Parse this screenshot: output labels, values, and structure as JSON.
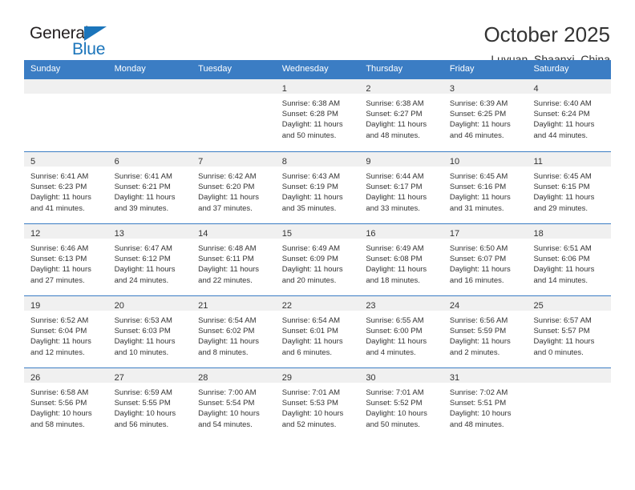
{
  "brand": {
    "name_top": "General",
    "name_bottom": "Blue",
    "accent_color": "#1b75bb",
    "triangle_icon": "triangle-icon"
  },
  "header": {
    "title": "October 2025",
    "subtitle": "Luyuan, Shaanxi, China"
  },
  "calendar": {
    "header_color": "#3b7dc4",
    "day_band_color": "#f0f0f0",
    "weekdays": [
      "Sunday",
      "Monday",
      "Tuesday",
      "Wednesday",
      "Thursday",
      "Friday",
      "Saturday"
    ],
    "weeks": [
      [
        {
          "day": "",
          "empty": true
        },
        {
          "day": "",
          "empty": true
        },
        {
          "day": "",
          "empty": true
        },
        {
          "day": "1",
          "sunrise": "Sunrise: 6:38 AM",
          "sunset": "Sunset: 6:28 PM",
          "daylight": "Daylight: 11 hours and 50 minutes."
        },
        {
          "day": "2",
          "sunrise": "Sunrise: 6:38 AM",
          "sunset": "Sunset: 6:27 PM",
          "daylight": "Daylight: 11 hours and 48 minutes."
        },
        {
          "day": "3",
          "sunrise": "Sunrise: 6:39 AM",
          "sunset": "Sunset: 6:25 PM",
          "daylight": "Daylight: 11 hours and 46 minutes."
        },
        {
          "day": "4",
          "sunrise": "Sunrise: 6:40 AM",
          "sunset": "Sunset: 6:24 PM",
          "daylight": "Daylight: 11 hours and 44 minutes."
        }
      ],
      [
        {
          "day": "5",
          "sunrise": "Sunrise: 6:41 AM",
          "sunset": "Sunset: 6:23 PM",
          "daylight": "Daylight: 11 hours and 41 minutes."
        },
        {
          "day": "6",
          "sunrise": "Sunrise: 6:41 AM",
          "sunset": "Sunset: 6:21 PM",
          "daylight": "Daylight: 11 hours and 39 minutes."
        },
        {
          "day": "7",
          "sunrise": "Sunrise: 6:42 AM",
          "sunset": "Sunset: 6:20 PM",
          "daylight": "Daylight: 11 hours and 37 minutes."
        },
        {
          "day": "8",
          "sunrise": "Sunrise: 6:43 AM",
          "sunset": "Sunset: 6:19 PM",
          "daylight": "Daylight: 11 hours and 35 minutes."
        },
        {
          "day": "9",
          "sunrise": "Sunrise: 6:44 AM",
          "sunset": "Sunset: 6:17 PM",
          "daylight": "Daylight: 11 hours and 33 minutes."
        },
        {
          "day": "10",
          "sunrise": "Sunrise: 6:45 AM",
          "sunset": "Sunset: 6:16 PM",
          "daylight": "Daylight: 11 hours and 31 minutes."
        },
        {
          "day": "11",
          "sunrise": "Sunrise: 6:45 AM",
          "sunset": "Sunset: 6:15 PM",
          "daylight": "Daylight: 11 hours and 29 minutes."
        }
      ],
      [
        {
          "day": "12",
          "sunrise": "Sunrise: 6:46 AM",
          "sunset": "Sunset: 6:13 PM",
          "daylight": "Daylight: 11 hours and 27 minutes."
        },
        {
          "day": "13",
          "sunrise": "Sunrise: 6:47 AM",
          "sunset": "Sunset: 6:12 PM",
          "daylight": "Daylight: 11 hours and 24 minutes."
        },
        {
          "day": "14",
          "sunrise": "Sunrise: 6:48 AM",
          "sunset": "Sunset: 6:11 PM",
          "daylight": "Daylight: 11 hours and 22 minutes."
        },
        {
          "day": "15",
          "sunrise": "Sunrise: 6:49 AM",
          "sunset": "Sunset: 6:09 PM",
          "daylight": "Daylight: 11 hours and 20 minutes."
        },
        {
          "day": "16",
          "sunrise": "Sunrise: 6:49 AM",
          "sunset": "Sunset: 6:08 PM",
          "daylight": "Daylight: 11 hours and 18 minutes."
        },
        {
          "day": "17",
          "sunrise": "Sunrise: 6:50 AM",
          "sunset": "Sunset: 6:07 PM",
          "daylight": "Daylight: 11 hours and 16 minutes."
        },
        {
          "day": "18",
          "sunrise": "Sunrise: 6:51 AM",
          "sunset": "Sunset: 6:06 PM",
          "daylight": "Daylight: 11 hours and 14 minutes."
        }
      ],
      [
        {
          "day": "19",
          "sunrise": "Sunrise: 6:52 AM",
          "sunset": "Sunset: 6:04 PM",
          "daylight": "Daylight: 11 hours and 12 minutes."
        },
        {
          "day": "20",
          "sunrise": "Sunrise: 6:53 AM",
          "sunset": "Sunset: 6:03 PM",
          "daylight": "Daylight: 11 hours and 10 minutes."
        },
        {
          "day": "21",
          "sunrise": "Sunrise: 6:54 AM",
          "sunset": "Sunset: 6:02 PM",
          "daylight": "Daylight: 11 hours and 8 minutes."
        },
        {
          "day": "22",
          "sunrise": "Sunrise: 6:54 AM",
          "sunset": "Sunset: 6:01 PM",
          "daylight": "Daylight: 11 hours and 6 minutes."
        },
        {
          "day": "23",
          "sunrise": "Sunrise: 6:55 AM",
          "sunset": "Sunset: 6:00 PM",
          "daylight": "Daylight: 11 hours and 4 minutes."
        },
        {
          "day": "24",
          "sunrise": "Sunrise: 6:56 AM",
          "sunset": "Sunset: 5:59 PM",
          "daylight": "Daylight: 11 hours and 2 minutes."
        },
        {
          "day": "25",
          "sunrise": "Sunrise: 6:57 AM",
          "sunset": "Sunset: 5:57 PM",
          "daylight": "Daylight: 11 hours and 0 minutes."
        }
      ],
      [
        {
          "day": "26",
          "sunrise": "Sunrise: 6:58 AM",
          "sunset": "Sunset: 5:56 PM",
          "daylight": "Daylight: 10 hours and 58 minutes."
        },
        {
          "day": "27",
          "sunrise": "Sunrise: 6:59 AM",
          "sunset": "Sunset: 5:55 PM",
          "daylight": "Daylight: 10 hours and 56 minutes."
        },
        {
          "day": "28",
          "sunrise": "Sunrise: 7:00 AM",
          "sunset": "Sunset: 5:54 PM",
          "daylight": "Daylight: 10 hours and 54 minutes."
        },
        {
          "day": "29",
          "sunrise": "Sunrise: 7:01 AM",
          "sunset": "Sunset: 5:53 PM",
          "daylight": "Daylight: 10 hours and 52 minutes."
        },
        {
          "day": "30",
          "sunrise": "Sunrise: 7:01 AM",
          "sunset": "Sunset: 5:52 PM",
          "daylight": "Daylight: 10 hours and 50 minutes."
        },
        {
          "day": "31",
          "sunrise": "Sunrise: 7:02 AM",
          "sunset": "Sunset: 5:51 PM",
          "daylight": "Daylight: 10 hours and 48 minutes."
        },
        {
          "day": "",
          "empty": true
        }
      ]
    ]
  }
}
